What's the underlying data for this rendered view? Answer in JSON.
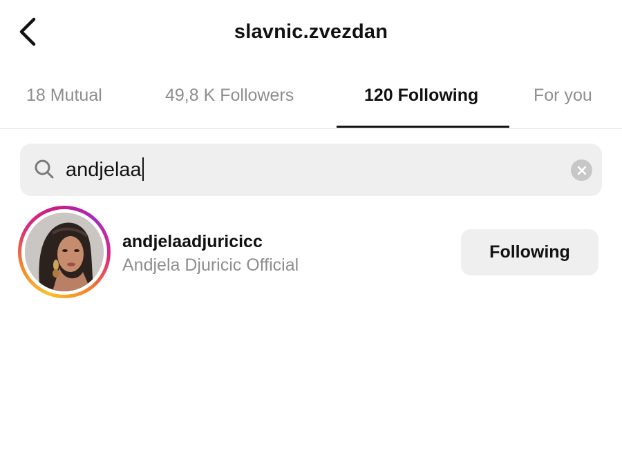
{
  "header": {
    "title": "slavnic.zvezdan",
    "back_icon": "chevron-left-icon"
  },
  "tabs": [
    {
      "label": "18 Mutual",
      "active": false
    },
    {
      "label": "49,8 K Followers",
      "active": false
    },
    {
      "label": "120 Following",
      "active": true
    },
    {
      "label": "For you",
      "active": false
    }
  ],
  "search": {
    "icon": "search-icon",
    "value": "andjelaa",
    "clear_icon": "clear-icon"
  },
  "results": [
    {
      "username": "andjelaadjuricicc",
      "full_name": "Andjela Djuricic Official",
      "button_label": "Following",
      "has_story_ring": true
    }
  ],
  "colors": {
    "text_primary": "#111111",
    "text_secondary": "#8e8e8e",
    "search_bg": "#efefef",
    "button_bg": "#efefef"
  }
}
